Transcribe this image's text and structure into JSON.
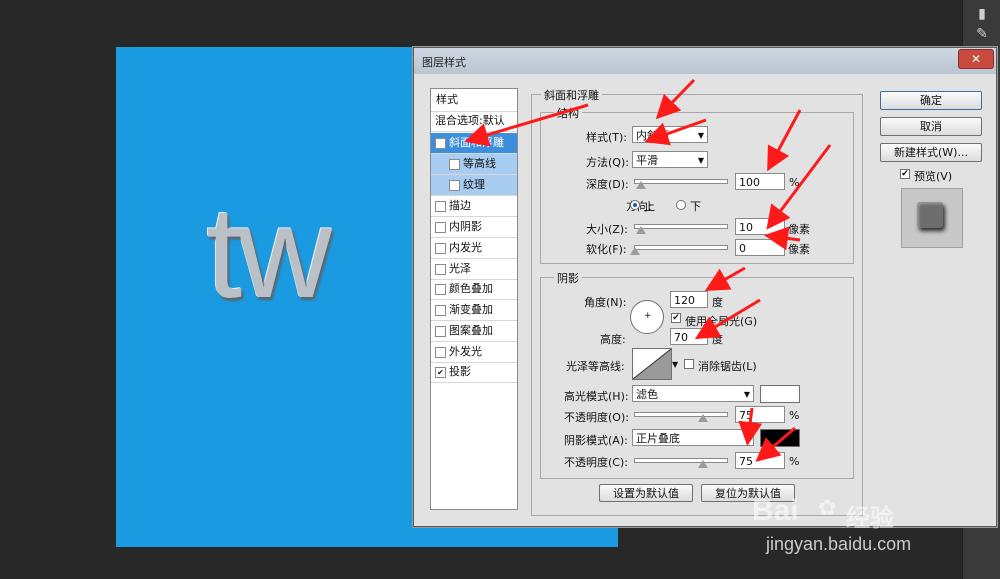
{
  "canvas": {
    "text": "tw",
    "color": "#1a9ae0"
  },
  "dialog": {
    "title": "图层样式",
    "close_label": "✕",
    "styles_header": "样式",
    "blend_options": "混合选项:默认",
    "style_items": [
      {
        "label": "斜面和浮雕",
        "checked": true
      },
      {
        "label": "等高线",
        "checked": false
      },
      {
        "label": "纹理",
        "checked": false
      },
      {
        "label": "描边",
        "checked": false
      },
      {
        "label": "内阴影",
        "checked": false
      },
      {
        "label": "内发光",
        "checked": false
      },
      {
        "label": "光泽",
        "checked": false
      },
      {
        "label": "颜色叠加",
        "checked": false
      },
      {
        "label": "渐变叠加",
        "checked": false
      },
      {
        "label": "图案叠加",
        "checked": false
      },
      {
        "label": "外发光",
        "checked": false
      },
      {
        "label": "投影",
        "checked": true
      }
    ],
    "bevel": {
      "section_title": "斜面和浮雕",
      "structure_title": "结构",
      "style_label": "样式(T):",
      "style_value": "内斜面",
      "technique_label": "方法(Q):",
      "technique_value": "平滑",
      "depth_label": "深度(D):",
      "depth_value": "100",
      "depth_unit": "%",
      "direction_label": "方向:",
      "direction_up": "上",
      "direction_down": "下",
      "size_label": "大小(Z):",
      "size_value": "10",
      "size_unit": "像素",
      "soften_label": "软化(F):",
      "soften_value": "0",
      "soften_unit": "像素"
    },
    "shading": {
      "title": "阴影",
      "angle_label": "角度(N):",
      "angle_value": "120",
      "angle_unit": "度",
      "global_light_label": "使用全局光(G)",
      "altitude_label": "高度:",
      "altitude_value": "70",
      "altitude_unit": "度",
      "gloss_label": "光泽等高线:",
      "antialias_label": "消除锯齿(L)",
      "highlight_mode_label": "高光模式(H):",
      "highlight_mode_value": "滤色",
      "highlight_color": "#ffffff",
      "highlight_opacity_label": "不透明度(O):",
      "highlight_opacity_value": "75",
      "highlight_opacity_unit": "%",
      "shadow_mode_label": "阴影模式(A):",
      "shadow_mode_value": "正片叠底",
      "shadow_color": "#000000",
      "shadow_opacity_label": "不透明度(C):",
      "shadow_opacity_value": "75",
      "shadow_opacity_unit": "%"
    },
    "make_default": "设置为默认值",
    "reset_default": "复位为默认值",
    "ok": "确定",
    "cancel": "取消",
    "new_style": "新建样式(W)...",
    "preview_label": "预览(V)"
  },
  "watermark": {
    "brand_a": "Bai",
    "brand_b": "经验",
    "url": "jingyan.baidu.com"
  }
}
